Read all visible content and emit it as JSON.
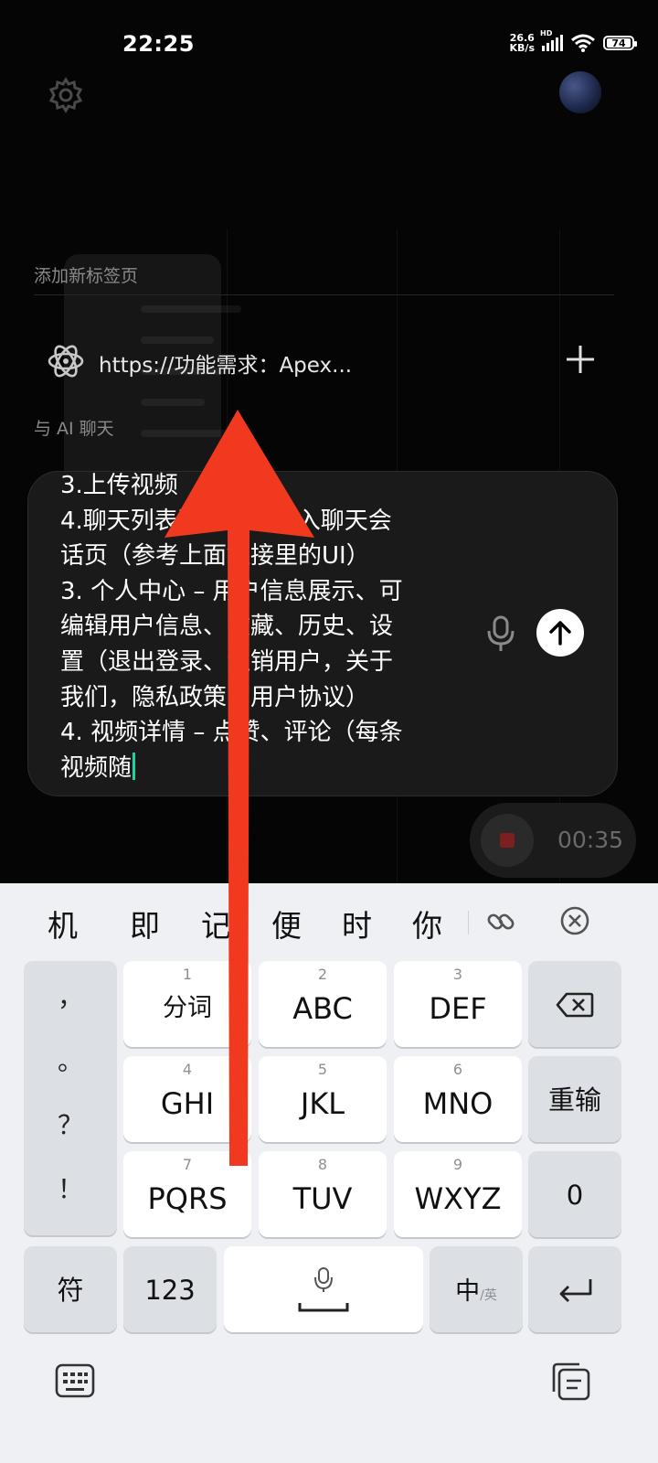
{
  "status_bar": {
    "time": "22:25",
    "net_speed_value": "26.6",
    "net_speed_unit": "KB/s",
    "signal_label": "HD",
    "battery": "74"
  },
  "browser_new_tab": {
    "add_tab_section": "添加新标签页",
    "new_tab_url": "https://功能需求：Apex...",
    "ai_chat_section": "与 AI 聊天"
  },
  "chat_input": {
    "lines": [
      "3.上传视频",
      "4.聊天列表页，点击进入聊天会",
      "话页（参考上面链接里的UI）",
      "3. 个人中心 – 用户信息展示、可",
      "编辑用户信息、收藏、历史、设",
      "置（退出登录、注销用户，关于",
      "我们，隐私政策、用户协议）",
      "4. 视频详情 – 点赞、评论（每条",
      "视频随"
    ]
  },
  "recording": {
    "time": "00:35"
  },
  "keyboard": {
    "candidates": [
      "机",
      "即",
      "记",
      "便",
      "时",
      "你"
    ],
    "left_punct": [
      "，",
      "。",
      "？",
      "！"
    ],
    "keys": [
      {
        "num": "1",
        "label": "分词"
      },
      {
        "num": "2",
        "label": "ABC"
      },
      {
        "num": "3",
        "label": "DEF"
      },
      {
        "num": "4",
        "label": "GHI"
      },
      {
        "num": "5",
        "label": "JKL"
      },
      {
        "num": "6",
        "label": "MNO"
      },
      {
        "num": "7",
        "label": "PQRS"
      },
      {
        "num": "8",
        "label": "TUV"
      },
      {
        "num": "9",
        "label": "WXYZ"
      }
    ],
    "reinput": "重输",
    "zero": "0",
    "symbols": "符",
    "num_mode": "123",
    "lang_main": "中",
    "lang_alt": "/英"
  },
  "colors": {
    "overlay_arrow": "#f0391f",
    "cursor": "#1fd1a3",
    "keyboard_bg": "#eef0f4"
  }
}
